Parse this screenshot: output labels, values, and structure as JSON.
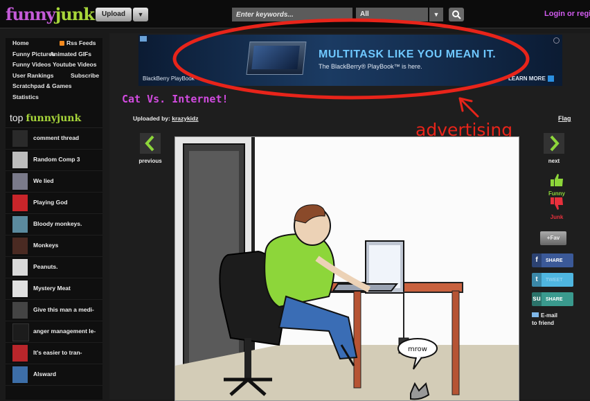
{
  "header": {
    "logo_part1": "funny",
    "logo_part2": "junk",
    "upload_label": "Upload",
    "search_placeholder": "Enter keywords...",
    "category_value": "All",
    "login_label": "Login or register"
  },
  "sidebar": {
    "nav": [
      {
        "left": "Home",
        "right": "Rss Feeds"
      },
      {
        "left": "Funny Pictures",
        "right": "Animated GIFs"
      },
      {
        "left": "Funny Videos",
        "right": "Youtube Videos"
      },
      {
        "left": "User Rankings",
        "right": "Subscribe"
      },
      {
        "left": "Scratchpad & Games",
        "right": ""
      },
      {
        "left": "Statistics",
        "right": ""
      }
    ],
    "top_prefix": "top",
    "top_brand": "funnyjunk",
    "top_items": [
      "comment thread",
      "Random Comp 3",
      "We lied",
      "Playing God",
      "Bloody monkeys.",
      "Monkeys",
      "Peanuts.",
      "Mystery Meat",
      "Give this man a medi-",
      "anger management le-",
      "It's easier to tran-",
      "Alsward"
    ]
  },
  "ad": {
    "title": "MULTITASK LIKE YOU MEAN IT.",
    "subtitle": "The BlackBerry® PlayBook™ is here.",
    "brand": "BlackBerry PlayBook",
    "cta": "LEARN MORE"
  },
  "post": {
    "title": "Cat Vs. Internet!",
    "uploaded_prefix": "Uploaded by:",
    "uploader": "krazykidz",
    "flag_label": "Flag",
    "previous_label": "previous",
    "next_label": "next",
    "speech": "mrow"
  },
  "annotation": "advertising",
  "actions": {
    "funny_label": "Funny",
    "junk_label": "Junk",
    "fav_label": "+Fav",
    "share_facebook": "SHARE",
    "share_twitter": "TWEET",
    "share_stumble": "SHARE",
    "email_label_1": "E-mail",
    "email_label_2": "to friend"
  },
  "colors": {
    "logo_purple": "#c45bd8",
    "logo_green": "#a7d63a",
    "title_purple": "#d24be0",
    "annotation_red": "#e8241a",
    "funny_green": "#8dd63a",
    "junk_red": "#e8303c"
  }
}
